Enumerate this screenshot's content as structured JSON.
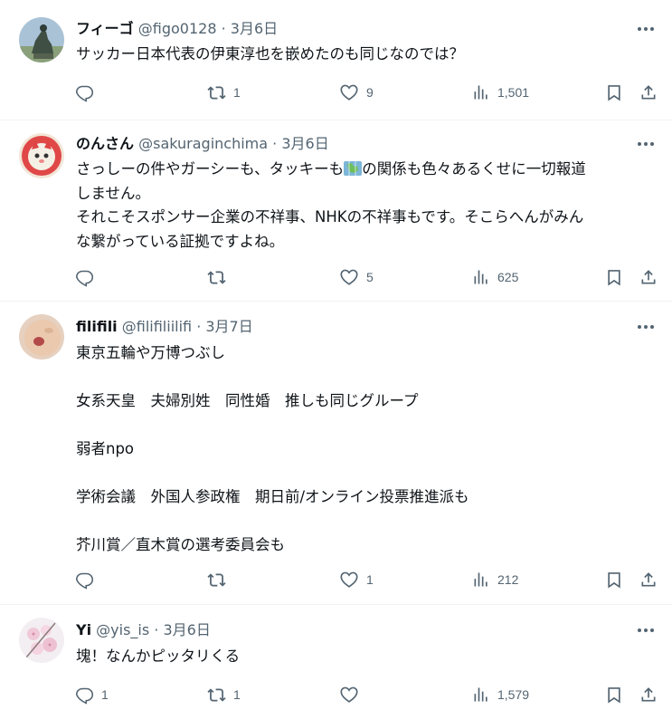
{
  "posts": [
    {
      "name": "フィーゴ",
      "handle": "@figo0128",
      "date": "3月6日",
      "lines": [
        "サッカー日本代表の伊東淳也を嵌めたのも同じなのでは？"
      ],
      "replies": "",
      "reposts": "1",
      "likes": "9",
      "views": "1,501"
    },
    {
      "name": "のんさん",
      "handle": "@sakuraginchima",
      "date": "3月6日",
      "line1_before": "さっしーの件やガーシーも、タッキーも",
      "line1_after": "の関係も色々あるくせに一切報道",
      "lines_rest": [
        "しません。",
        "それこそスポンサー企業の不祥事、NHKの不祥事もです。そこらへんがみん",
        "な繋がっている証拠ですよね。"
      ],
      "replies": "",
      "reposts": "",
      "likes": "5",
      "views": "625"
    },
    {
      "name": "filifili",
      "handle": "@filifiliilifi",
      "date": "3月7日",
      "lines": [
        "東京五輪や万博つぶし",
        "",
        "女系天皇　夫婦別姓　同性婚　推しも同じグループ",
        "",
        "弱者npo",
        "",
        "学術会議　外国人参政権　期日前/オンライン投票推進派も",
        "",
        "芥川賞／直木賞の選考委員会も"
      ],
      "replies": "",
      "reposts": "",
      "likes": "1",
      "views": "212"
    },
    {
      "name": "Yi",
      "handle": "@yis_is",
      "date": "3月6日",
      "lines": [
        "塊！なんかピッタリくる"
      ],
      "replies": "1",
      "reposts": "1",
      "likes": "",
      "views": "1,579"
    }
  ],
  "separator": " · ",
  "colors": {
    "text": "#0f1419",
    "secondary": "#536471",
    "divider": "#eff3f4"
  },
  "icons": [
    "reply-icon",
    "repost-icon",
    "like-icon",
    "views-icon",
    "bookmark-icon",
    "share-icon",
    "more-icon",
    "map-emoji-icon"
  ]
}
